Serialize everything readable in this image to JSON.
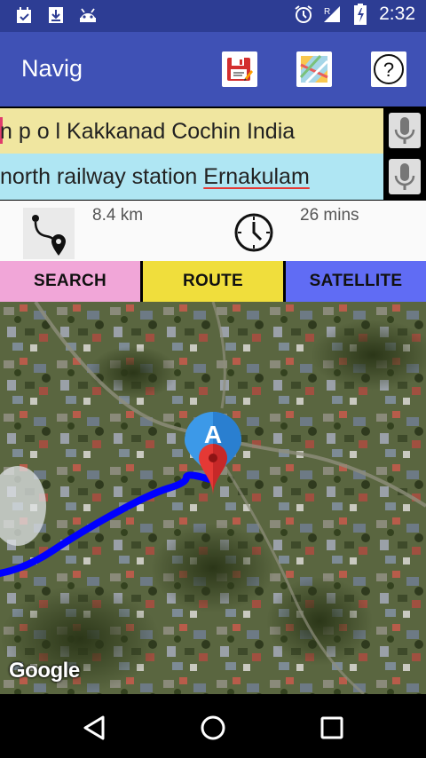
{
  "status_bar": {
    "time": "2:32",
    "icons": [
      "calendar-icon",
      "download-icon",
      "android-icon",
      "alarm-icon",
      "signal-icon",
      "battery-icon"
    ]
  },
  "app": {
    "title": "Navig",
    "actions": [
      "save-icon",
      "map-icon",
      "help-icon"
    ]
  },
  "search": {
    "origin_text": "n p o l Kakkanad Cochin India",
    "destination_prefix": "north railway station ",
    "destination_word": "Ernakulam"
  },
  "route_info": {
    "distance": "8.4 km",
    "duration": "26 mins"
  },
  "tabs": [
    {
      "label": "SEARCH",
      "color": "#f1a6d8"
    },
    {
      "label": "ROUTE",
      "color": "#f0de3c"
    },
    {
      "label": "SATELLITE",
      "color": "#606cf4"
    }
  ],
  "map": {
    "marker_label": "A",
    "attribution": "Google",
    "route_color": "#0000ff"
  },
  "colors": {
    "status_bar": "#2d3d94",
    "app_bar": "#3f51b5"
  }
}
